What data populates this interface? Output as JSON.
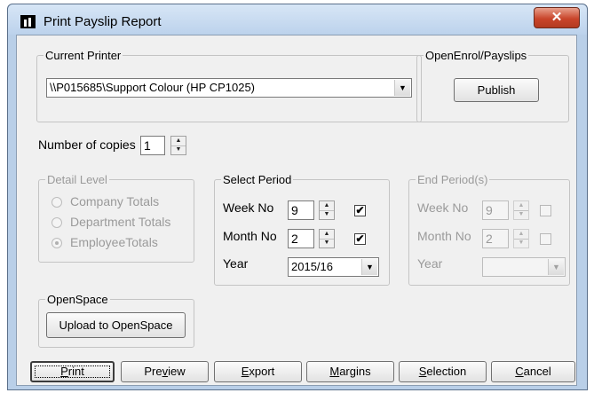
{
  "window": {
    "title": "Print Payslip Report",
    "close_glyph": "✕"
  },
  "current_printer": {
    "legend": "Current Printer",
    "selected": "\\\\P015685\\Support Colour (HP CP1025)"
  },
  "open_enrol": {
    "legend": "OpenEnrol/Payslips",
    "publish_label": "Publish"
  },
  "copies": {
    "label": "Number of copies",
    "value": "1"
  },
  "detail_level": {
    "legend": "Detail Level",
    "options": [
      "Company Totals",
      "Department Totals",
      "EmployeeTotals"
    ],
    "selected_index": 2
  },
  "select_period": {
    "legend": "Select Period",
    "week_label": "Week No",
    "week_value": "9",
    "week_checked": true,
    "month_label": "Month No",
    "month_value": "2",
    "month_checked": true,
    "year_label": "Year",
    "year_value": "2015/16"
  },
  "end_period": {
    "legend": "End Period(s)",
    "week_label": "Week No",
    "week_value": "9",
    "month_label": "Month No",
    "month_value": "2",
    "year_label": "Year"
  },
  "open_space": {
    "legend": "OpenSpace",
    "upload_label": "Upload to OpenSpace"
  },
  "buttons": {
    "print": {
      "first": "P",
      "rest": "rint"
    },
    "preview": {
      "pre": "Pre",
      "u": "v",
      "post": "iew"
    },
    "export": {
      "first": "E",
      "rest": "xport"
    },
    "margins": {
      "first": "M",
      "rest": "argins"
    },
    "selection": {
      "first": "S",
      "rest": "election"
    },
    "cancel": {
      "first": "C",
      "rest": "ancel"
    }
  },
  "icons": {
    "dropdown": "dropdown-arrow-icon",
    "spin": "spin-arrows-icon",
    "check": "checkmark-icon",
    "app": "app-icon",
    "close": "close-icon"
  },
  "glyphs": {
    "up": "▲",
    "down": "▼",
    "check": "✔"
  },
  "colors": {
    "title_bar": "#bcd2ec",
    "close_button": "#c9452b",
    "dialog_face": "#f0f0f0"
  }
}
